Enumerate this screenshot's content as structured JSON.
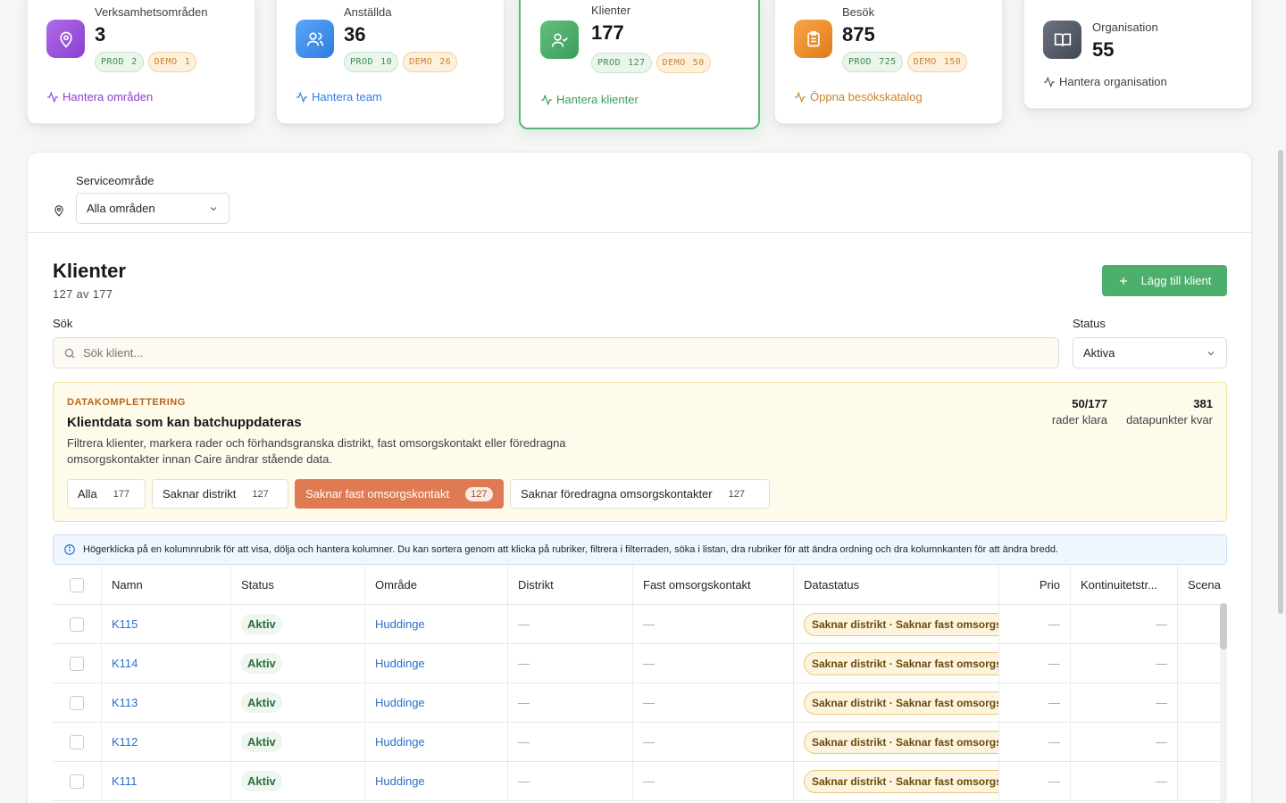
{
  "stats": [
    {
      "label": "Verksamhetsområden",
      "value": "3",
      "prod": "PROD",
      "prod_count": "2",
      "demo": "DEMO",
      "demo_count": "1",
      "link": "Hantera områden",
      "icon": "map-pin-icon",
      "color": "#9b4fd6"
    },
    {
      "label": "Anställda",
      "value": "36",
      "prod": "PROD",
      "prod_count": "10",
      "demo": "DEMO",
      "demo_count": "26",
      "link": "Hantera team",
      "icon": "users-icon",
      "color": "#3b82f6"
    },
    {
      "label": "Klienter",
      "value": "177",
      "prod": "PROD",
      "prod_count": "127",
      "demo": "DEMO",
      "demo_count": "50",
      "link": "Hantera klienter",
      "icon": "user-check-icon",
      "color": "#3e9b5c"
    },
    {
      "label": "Besök",
      "value": "875",
      "prod": "PROD",
      "prod_count": "725",
      "demo": "DEMO",
      "demo_count": "150",
      "link": "Öppna besökskatalog",
      "icon": "clipboard-icon",
      "color": "#e08a1f"
    },
    {
      "label": "Organisation",
      "value": "55",
      "link": "Hantera organisation",
      "icon": "book-open-icon",
      "color": "#4b5563"
    }
  ],
  "service": {
    "label": "Serviceområde",
    "selected": "Alla områden"
  },
  "clients": {
    "title": "Klienter",
    "count_text": "127 av 177",
    "add_label": "Lägg till klient",
    "search_label": "Sök",
    "search_placeholder": "Sök klient...",
    "status_label": "Status",
    "status_selected": "Aktiva"
  },
  "datakomplettering": {
    "tag": "DATAKOMPLETTERING",
    "title": "Klientdata som kan batchuppdateras",
    "desc": "Filtrera klienter, markera rader och förhandsgranska distrikt, fast omsorgskontakt eller föredragna omsorgskontakter innan Caire ändrar stående data.",
    "stat1_value": "50/177",
    "stat1_label": "rader klara",
    "stat2_value": "381",
    "stat2_label": "datapunkter kvar",
    "filters": [
      {
        "label": "Alla",
        "count": "177"
      },
      {
        "label": "Saknar distrikt",
        "count": "127"
      },
      {
        "label": "Saknar fast omsorgskontakt",
        "count": "127",
        "active": true
      },
      {
        "label": "Saknar föredragna omsorgskontakter",
        "count": "127"
      }
    ]
  },
  "info_text": "Högerklicka på en kolumnrubrik för att visa, dölja och hantera kolumner. Du kan sortera genom att klicka på rubriker, filtrera i filterraden, söka i listan, dra rubriker för att ändra ordning och dra kolumnkanten för att ändra bredd.",
  "table": {
    "columns": [
      "Namn",
      "Status",
      "Område",
      "Distrikt",
      "Fast omsorgskontakt",
      "Datastatus",
      "Prio",
      "Kontinuitetstr...",
      "Scena"
    ],
    "rows": [
      {
        "name": "K115",
        "status": "Aktiv",
        "area": "Huddinge",
        "district": "—",
        "contact": "—",
        "datastatus": "Saknar distrikt · Saknar fast omsorgskontakt",
        "prio": "—",
        "kont": "—"
      },
      {
        "name": "K114",
        "status": "Aktiv",
        "area": "Huddinge",
        "district": "—",
        "contact": "—",
        "datastatus": "Saknar distrikt · Saknar fast omsorgskontakt",
        "prio": "—",
        "kont": "—"
      },
      {
        "name": "K113",
        "status": "Aktiv",
        "area": "Huddinge",
        "district": "—",
        "contact": "—",
        "datastatus": "Saknar distrikt · Saknar fast omsorgskontakt",
        "prio": "—",
        "kont": "—"
      },
      {
        "name": "K112",
        "status": "Aktiv",
        "area": "Huddinge",
        "district": "—",
        "contact": "—",
        "datastatus": "Saknar distrikt · Saknar fast omsorgskontakt",
        "prio": "—",
        "kont": "—"
      },
      {
        "name": "K111",
        "status": "Aktiv",
        "area": "Huddinge",
        "district": "—",
        "contact": "—",
        "datastatus": "Saknar distrikt · Saknar fast omsorgskontakt",
        "prio": "—",
        "kont": "—"
      }
    ]
  }
}
